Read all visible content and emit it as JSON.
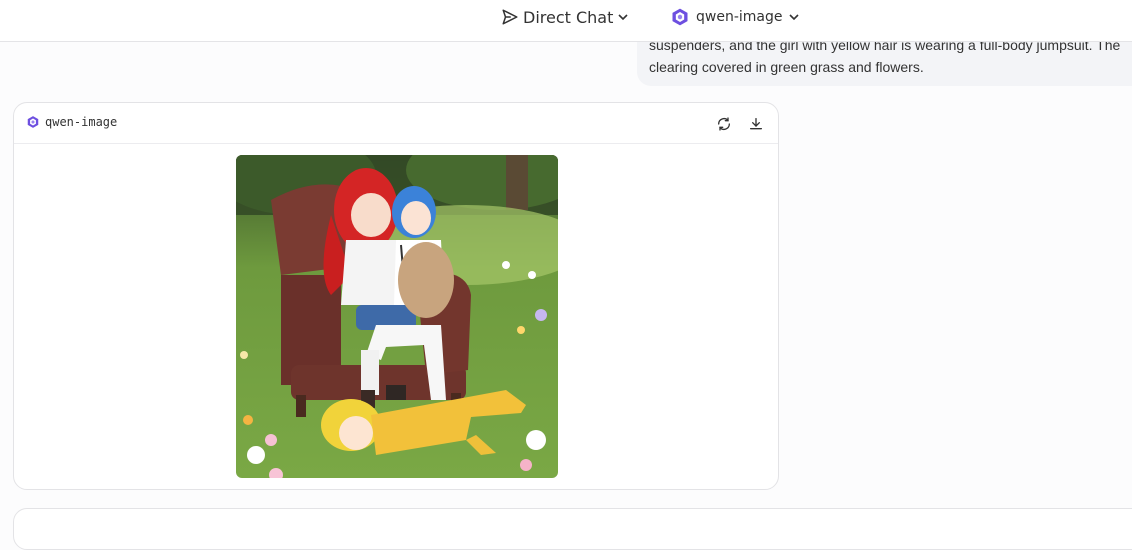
{
  "header": {
    "mode_label": "Direct Chat",
    "model_label": "qwen-image"
  },
  "user_message": {
    "line1": "suspenders, and the girl with yellow hair is wearing a full-body jumpsuit. The",
    "line2": "clearing covered in green grass and flowers."
  },
  "response": {
    "model_name": "qwen-image",
    "actions": [
      "refresh-icon",
      "download-icon"
    ]
  },
  "colors": {
    "accent": "#6d4fe0",
    "card_border": "#e3e3e6",
    "user_bubble": "#f3f4f7"
  }
}
